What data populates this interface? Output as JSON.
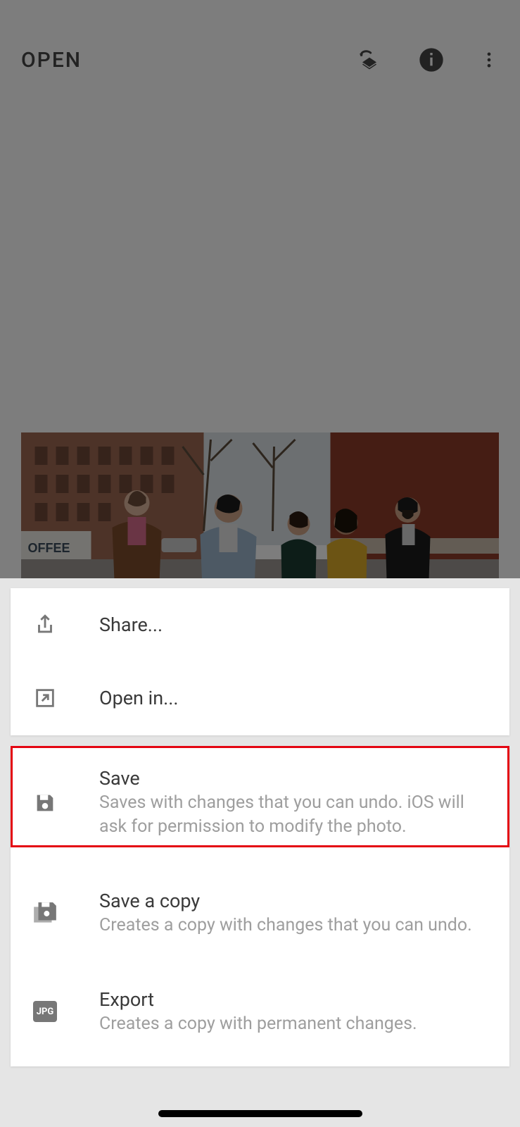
{
  "toolbar": {
    "open_label": "OPEN",
    "icons": {
      "undo_layers": "undo-layers-icon",
      "info": "info-icon",
      "more": "more-vertical-icon"
    }
  },
  "sheet": {
    "group1": [
      {
        "title": "Share...",
        "icon": "share-icon"
      },
      {
        "title": "Open in...",
        "icon": "open-external-icon"
      }
    ],
    "group2": [
      {
        "title": "Save",
        "desc": "Saves with changes that you can undo. iOS will ask for permission to modify the photo.",
        "icon": "save-icon"
      },
      {
        "title": "Save a copy",
        "desc": "Creates a copy with changes that you can undo.",
        "icon": "save-copy-icon"
      },
      {
        "title": "Export",
        "desc": "Creates a copy with permanent changes.",
        "icon": "jpg-icon",
        "badge": "JPG"
      }
    ]
  },
  "highlighted_item_index": 0,
  "colors": {
    "highlight": "#e40613",
    "text_primary": "#3a3a3a",
    "text_secondary": "#9e9e9e",
    "icon": "#777"
  }
}
